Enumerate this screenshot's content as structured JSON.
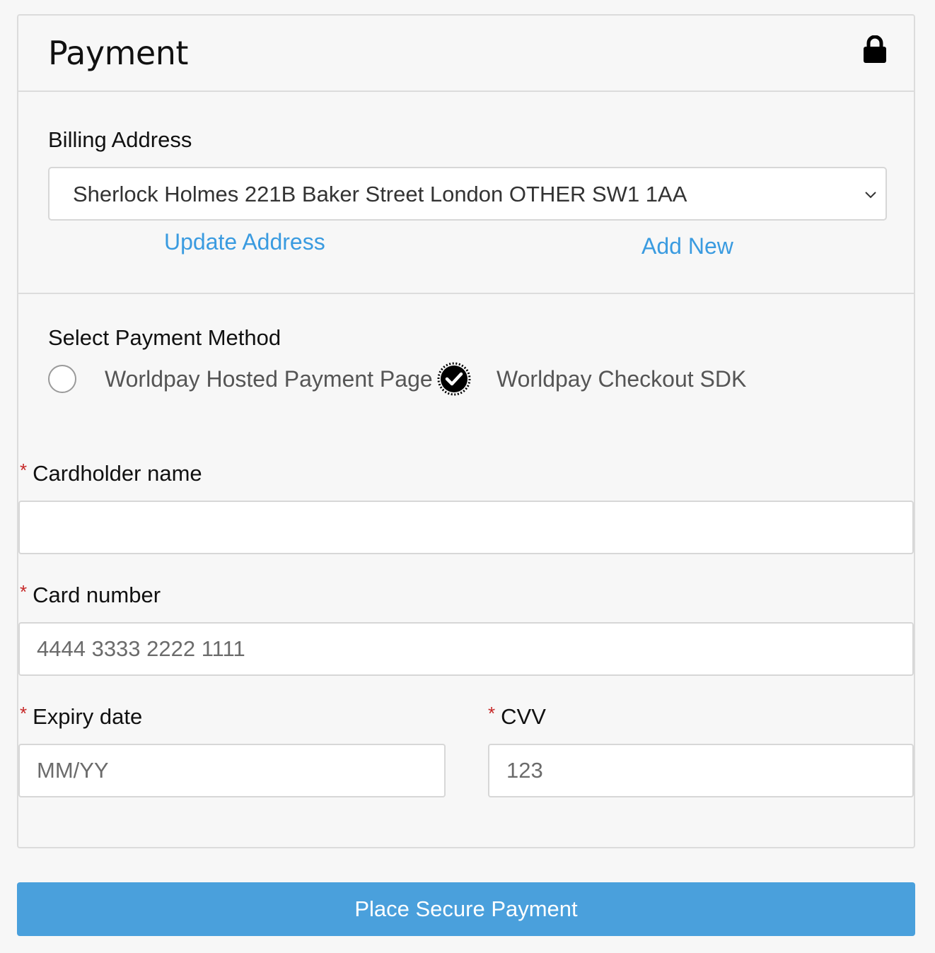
{
  "panel": {
    "title": "Payment",
    "lock_icon": "lock-icon"
  },
  "billing": {
    "label": "Billing Address",
    "selected_address": "Sherlock Holmes 221B Baker Street London OTHER SW1 1AA",
    "update_link": "Update Address",
    "add_new_link": "Add New"
  },
  "payment_method": {
    "label": "Select Payment Method",
    "options": [
      {
        "label": "Worldpay Hosted Payment Page",
        "selected": false
      },
      {
        "label": "Worldpay Checkout SDK",
        "selected": true
      }
    ]
  },
  "form": {
    "required_mark": "*",
    "cardholder": {
      "label": "Cardholder name",
      "value": "",
      "placeholder": ""
    },
    "card_number": {
      "label": "Card number",
      "value": "",
      "placeholder": "4444 3333 2222 1111"
    },
    "expiry": {
      "label": "Expiry date",
      "value": "",
      "placeholder": "MM/YY"
    },
    "cvv": {
      "label": "CVV",
      "value": "",
      "placeholder": "123"
    }
  },
  "submit": {
    "label": "Place Secure Payment"
  },
  "colors": {
    "link": "#3a9be0",
    "button": "#4aa0dc",
    "required": "#c62828",
    "background": "#f7f7f7",
    "border": "#dcdcdc"
  }
}
